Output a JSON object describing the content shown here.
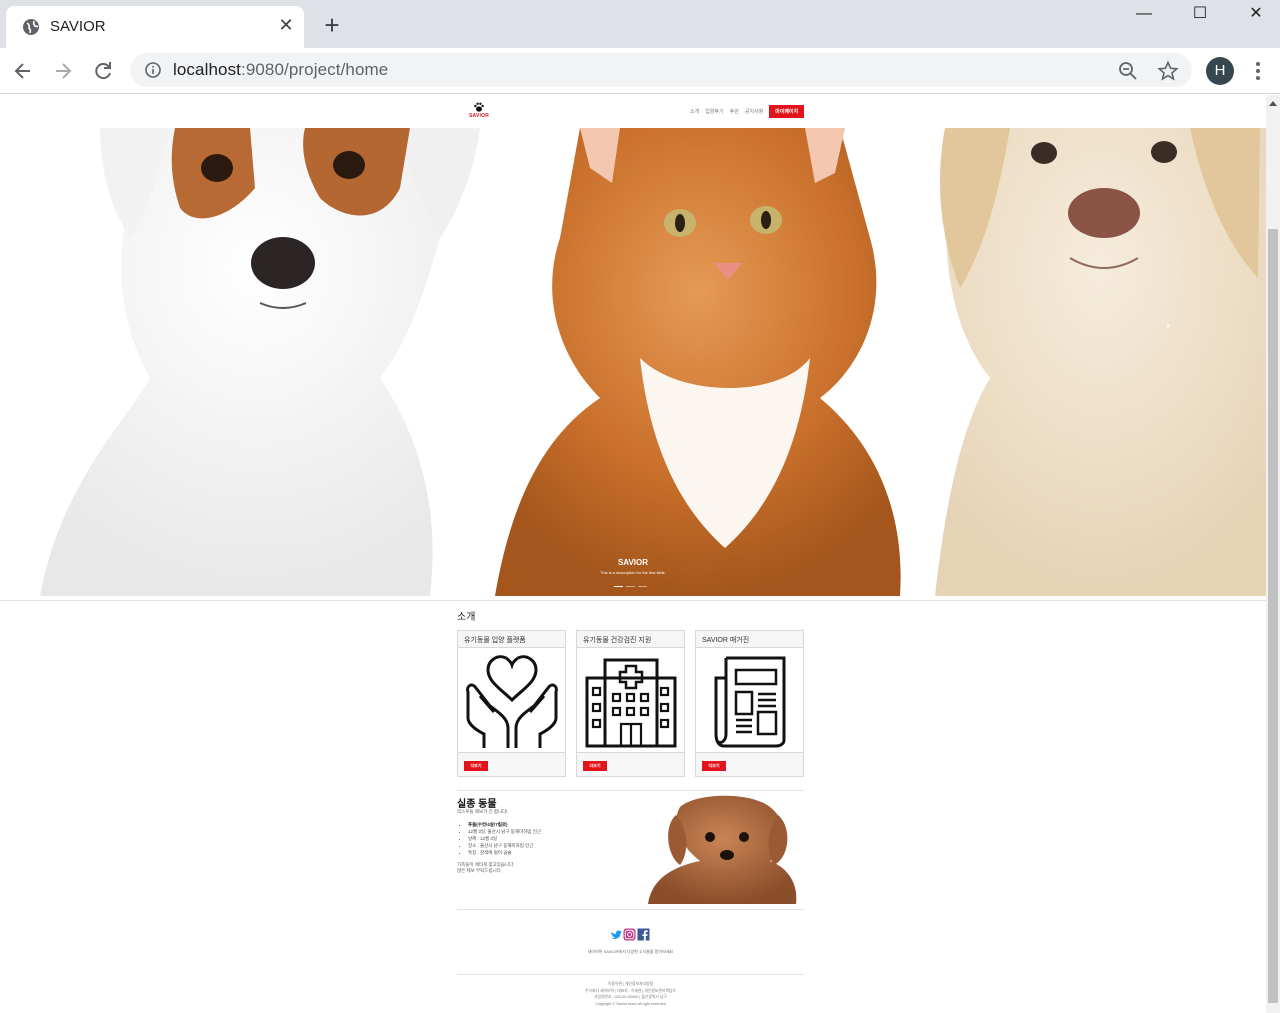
{
  "browser": {
    "tab_title": "SAVIOR",
    "tab_close": "✕",
    "new_tab": "+",
    "url_host": "localhost",
    "url_rest": ":9080/project/home",
    "profile_initial": "H",
    "window_controls": {
      "minimize": "—",
      "maximize": "☐",
      "close": "✕"
    }
  },
  "site": {
    "logo_text": "SAVIOR",
    "nav": {
      "item1": "소개",
      "item2": "입양후기",
      "item3": "후원",
      "item4": "공지사항",
      "mypage": "마이페이지"
    },
    "hero": {
      "title": "SAVIOR",
      "description": "This is a description for the first slide.",
      "next_arrow": "›"
    },
    "intro": {
      "heading": "소개",
      "cards": [
        {
          "title": "유기동물 입양 플랫폼",
          "button": "더보기",
          "icon": "heart-hands-icon"
        },
        {
          "title": "유기동물 건강검진 지원",
          "button": "더보기",
          "icon": "hospital-icon"
        },
        {
          "title": "SAVIOR 매거진",
          "button": "더보기",
          "icon": "newspaper-icon"
        }
      ]
    },
    "missing": {
      "heading": "실종 동물",
      "subtitle": "믹스푸들 제보가 긴 합니다!",
      "items": [
        "푸들(수컷/4살/7킬로)",
        "12월 3일, 울산시 남구 동해미하빔 인근",
        "날짜 : 12월 3일",
        "장소 : 울산시 남구 동해미하빔 인근",
        "특징 : 갈색에 털이 곱슬"
      ],
      "note_line1": "가족들이 애타게 찾고있습니다",
      "note_line2": "많은 제보 부탁드립니다"
    },
    "footer": {
      "tagline": "세이비어 SAVIOR에서 다양한 소식들을 받아보세요",
      "links": "이용약관 | 개인정보처리방침",
      "info1": "주식회사 세이비어 | 대표자 : 이세현 | 개인정보관리책임자",
      "info2": "사업자번호 : 000-00-00000 | 울산광역시 남구",
      "copyright": "Copyright © Savior team all right reserved"
    }
  },
  "colors": {
    "accent_red": "#e3131b",
    "chrome_bg": "#dee1e6",
    "omnibox_bg": "#f1f3f4"
  }
}
